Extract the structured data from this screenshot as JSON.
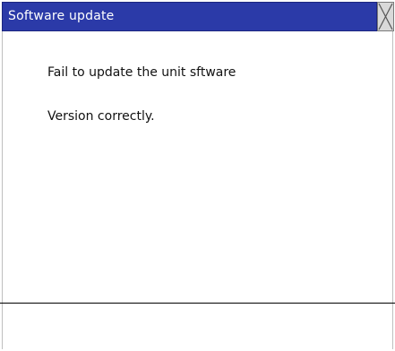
{
  "window": {
    "title": "Software update"
  },
  "controls": {
    "close_icon": "close-x-icon"
  },
  "message": {
    "line1": "Fail to update the unit sftware",
    "line2": "Version correctly."
  },
  "colors": {
    "titlebar": "#2b3aa8",
    "title_text": "#ffffff",
    "close_button": "#d9d9d9",
    "background": "#ffffff"
  }
}
